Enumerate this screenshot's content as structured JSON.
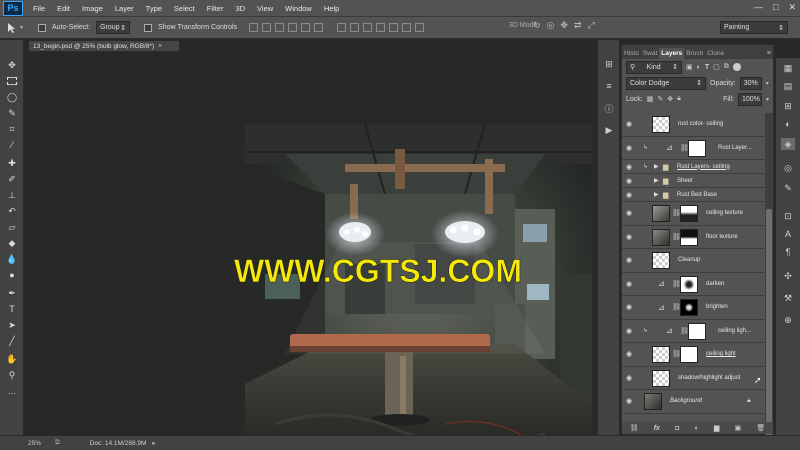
{
  "app": {
    "logo": "Ps"
  },
  "menu": [
    "File",
    "Edit",
    "Image",
    "Layer",
    "Type",
    "Select",
    "Filter",
    "3D",
    "View",
    "Window",
    "Help"
  ],
  "window_controls": [
    "—",
    "□",
    "✕"
  ],
  "options": {
    "auto_select_label": "Auto-Select:",
    "auto_select_value": "Group",
    "show_transform_label": "Show Transform Controls",
    "mode_3d_label": "3D Mode:",
    "workspace": "Painting"
  },
  "document": {
    "tab_title": "13_begin.psd @ 25% (bulb glow, RGB/8*)",
    "close": "×",
    "watermark": "WWW.CGTSJ.COM"
  },
  "status": {
    "zoom": "25%",
    "doc_info": "Doc: 14.1M/288.9M"
  },
  "panel": {
    "tabs": [
      "Histo",
      "Swat",
      "Layers",
      "Brush",
      "Clone"
    ],
    "kind_label": "Kind",
    "blend_mode": "Color Dodge",
    "opacity_label": "Opacity:",
    "opacity_value": "30%",
    "lock_label": "Lock:",
    "fill_label": "Fill:",
    "fill_value": "100%",
    "layers": [
      {
        "name": "rust color- ceiling",
        "type": "plain"
      },
      {
        "name": "Rust Layer...",
        "type": "masked"
      },
      {
        "name": "Rust Layers- ceiling",
        "type": "group"
      },
      {
        "name": "Sheet",
        "type": "group"
      },
      {
        "name": "Rust Bed Base",
        "type": "group"
      },
      {
        "name": "ceiling texture",
        "type": "image"
      },
      {
        "name": "floor texture",
        "type": "image"
      },
      {
        "name": "Cleanup",
        "type": "plain"
      },
      {
        "name": "darken",
        "type": "adjust"
      },
      {
        "name": "brighten",
        "type": "adjust"
      },
      {
        "name": "ceiling ligh...",
        "type": "masked"
      },
      {
        "name": "ceiling light",
        "type": "masked2"
      },
      {
        "name": "shadow/highlight adjust",
        "type": "plain"
      },
      {
        "name": "Background",
        "type": "bg"
      }
    ],
    "footer_icons": [
      "link-icon",
      "fx-icon",
      "mask-icon",
      "adjustment-icon",
      "folder-icon",
      "new-layer-icon",
      "trash-icon"
    ]
  }
}
